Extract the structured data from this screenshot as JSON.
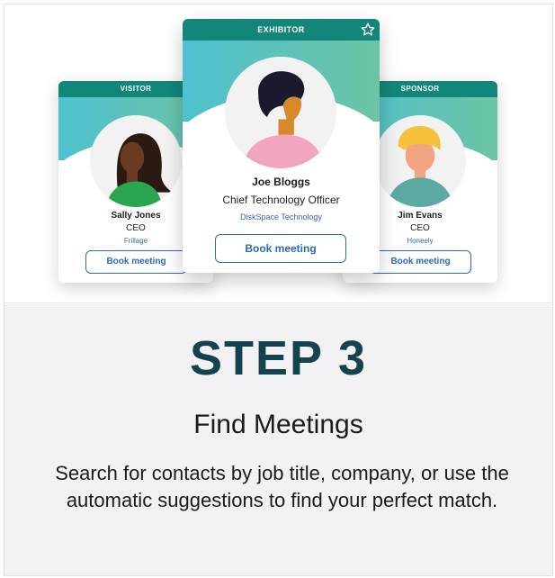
{
  "cards": {
    "left": {
      "badge": "VISITOR",
      "name": "Sally Jones",
      "role": "CEO",
      "company": "Frillage",
      "button": "Book meeting"
    },
    "center": {
      "badge": "EXHIBITOR",
      "name": "Joe Bloggs",
      "role": "Chief Technology Officer",
      "company": "DiskSpace Technology",
      "button": "Book meeting",
      "favorite_icon": "star-outline-icon"
    },
    "right": {
      "badge": "SPONSOR",
      "name": "Jim Evans",
      "role": "CEO",
      "company": "Honeely",
      "button": "Book meeting"
    }
  },
  "step": {
    "title": "STEP 3",
    "heading": "Find Meetings",
    "description": "Search for contacts by job title, company, or use the automatic suggestions to find your perfect match."
  },
  "colors": {
    "header_teal": "#13867a",
    "hero_gradient_start": "#4fc1d0",
    "hero_gradient_end": "#6cc4a3",
    "link_blue": "#2f6bb2",
    "step_title": "#14424f",
    "bottom_bg": "#f2f2f5"
  }
}
